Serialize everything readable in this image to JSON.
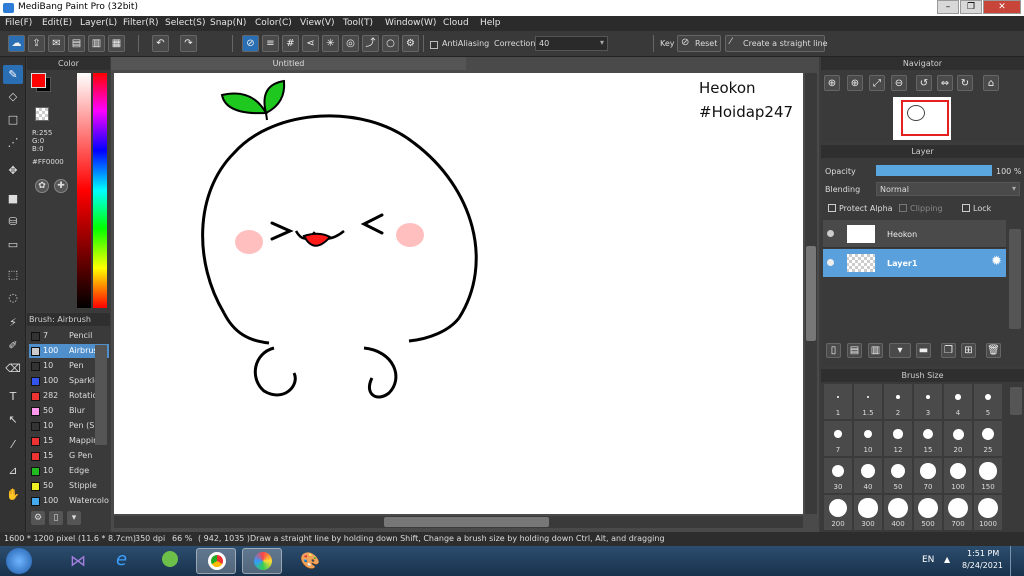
{
  "window": {
    "title": "MediBang Paint Pro (32bit)"
  },
  "menu": [
    "File(F)",
    "Edit(E)",
    "Layer(L)",
    "Filter(R)",
    "Select(S)",
    "Snap(N)",
    "Color(C)",
    "View(V)",
    "Tool(T)",
    "Window(W)",
    "Cloud",
    "Help"
  ],
  "toolbar": {
    "antialiasing_label": "AntiAliasing",
    "correction_label": "Correction",
    "correction_value": "40",
    "key_label": "Key",
    "reset_label": "Reset",
    "straight_line_label": "Create a straight line"
  },
  "color_panel": {
    "title": "Color",
    "r": "R:255",
    "g": "G:0",
    "b": "B:0",
    "hex": "#FF0000",
    "primary_color": "#ff0000",
    "secondary_color": "#000000"
  },
  "brush_panel": {
    "title": "Brush: Airbrush",
    "items": [
      {
        "size": "7",
        "name": "Pencil",
        "color": "#333333"
      },
      {
        "size": "100",
        "name": "Airbrush",
        "color": "#cccccc",
        "selected": true
      },
      {
        "size": "10",
        "name": "Pen",
        "color": "#333333"
      },
      {
        "size": "100",
        "name": "Sparkle",
        "color": "#3355ee"
      },
      {
        "size": "282",
        "name": "Rotation",
        "color": "#ee3333"
      },
      {
        "size": "50",
        "name": "Blur",
        "color": "#ff99ee"
      },
      {
        "size": "10",
        "name": "Pen (S",
        "color": "#333333"
      },
      {
        "size": "15",
        "name": "Mapping",
        "color": "#ee3333"
      },
      {
        "size": "15",
        "name": "G Pen",
        "color": "#ee3333"
      },
      {
        "size": "10",
        "name": "Edge",
        "color": "#22bb22"
      },
      {
        "size": "50",
        "name": "Stipple",
        "color": "#eeee22"
      },
      {
        "size": "100",
        "name": "Watercolor",
        "color": "#44aaee"
      }
    ]
  },
  "document": {
    "tab_title": "Untitled",
    "watermark_line1": "Heokon",
    "watermark_line2": "#Hoidap247"
  },
  "navigator": {
    "title": "Navigator"
  },
  "layer_panel": {
    "title": "Layer",
    "opacity_label": "Opacity",
    "opacity_value": "100 %",
    "opacity_fraction": 1.0,
    "blending_label": "Blending",
    "blending_value": "Normal",
    "protect_alpha": "Protect Alpha",
    "clipping": "Clipping",
    "lock": "Lock",
    "layers": [
      {
        "name": "Heokon",
        "selected": false
      },
      {
        "name": "Layer1",
        "selected": true
      }
    ]
  },
  "brush_size_panel": {
    "title": "Brush Size",
    "sizes": [
      "1",
      "1.5",
      "2",
      "3",
      "4",
      "5",
      "7",
      "10",
      "12",
      "15",
      "20",
      "25",
      "30",
      "40",
      "50",
      "70",
      "100",
      "150",
      "200",
      "300",
      "400",
      "500",
      "700",
      "1000"
    ]
  },
  "status": {
    "pixels": "1600 * 1200 pixel",
    "cm": "(11.6 * 8.7cm)",
    "dpi": "350 dpi",
    "zoom": "66 %",
    "coords": "( 942, 1035 )",
    "hint": "Draw a straight line by holding down Shift, Change a brush size by holding down Ctrl, Alt, and dragging"
  },
  "taskbar": {
    "lang": "EN",
    "time": "1:51 PM",
    "date": "8/24/2021"
  }
}
